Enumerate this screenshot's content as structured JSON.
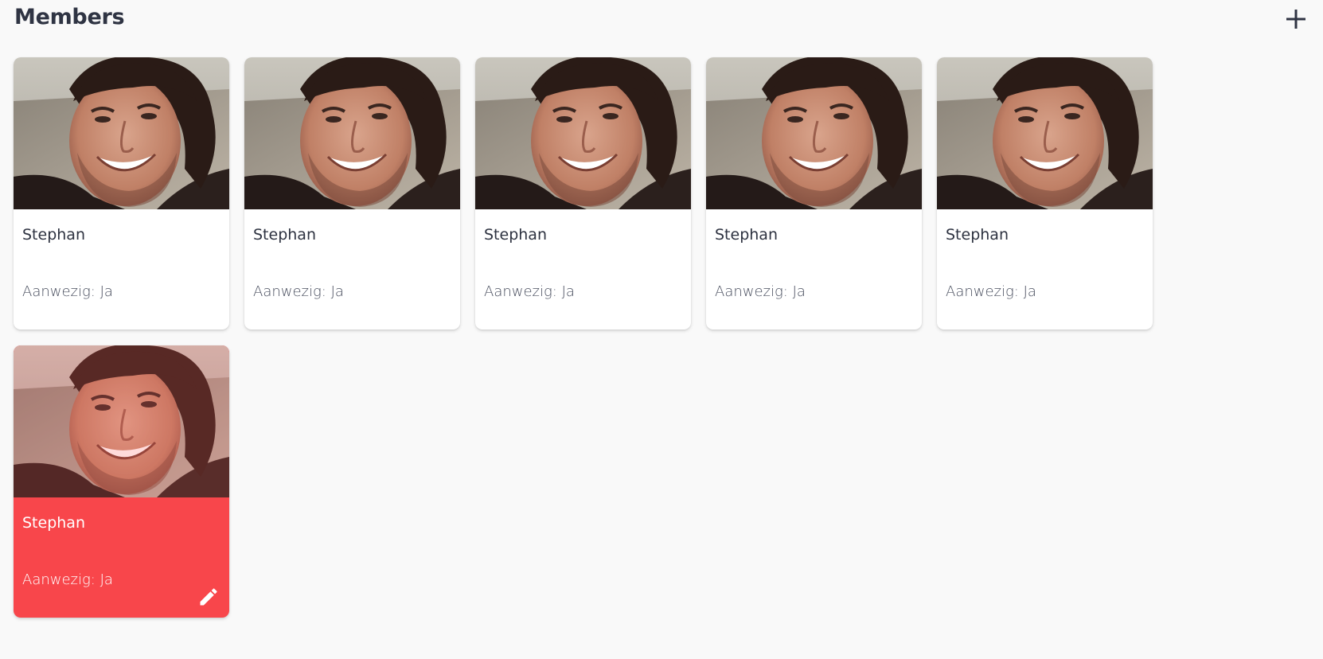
{
  "header": {
    "title": "Members",
    "add_icon": "plus-icon"
  },
  "members": [
    {
      "name": "Stephan",
      "presence": "Aanwezig: Ja",
      "selected": false
    },
    {
      "name": "Stephan",
      "presence": "Aanwezig: Ja",
      "selected": false
    },
    {
      "name": "Stephan",
      "presence": "Aanwezig: Ja",
      "selected": false
    },
    {
      "name": "Stephan",
      "presence": "Aanwezig: Ja",
      "selected": false
    },
    {
      "name": "Stephan",
      "presence": "Aanwezig: Ja",
      "selected": false
    },
    {
      "name": "Stephan",
      "presence": "Aanwezig: Ja",
      "selected": true
    }
  ],
  "edit_icon": "pencil-icon",
  "colors": {
    "background": "#f9f9f9",
    "card": "#ffffff",
    "selected_card": "#f8464b",
    "text": "#2d3240"
  }
}
